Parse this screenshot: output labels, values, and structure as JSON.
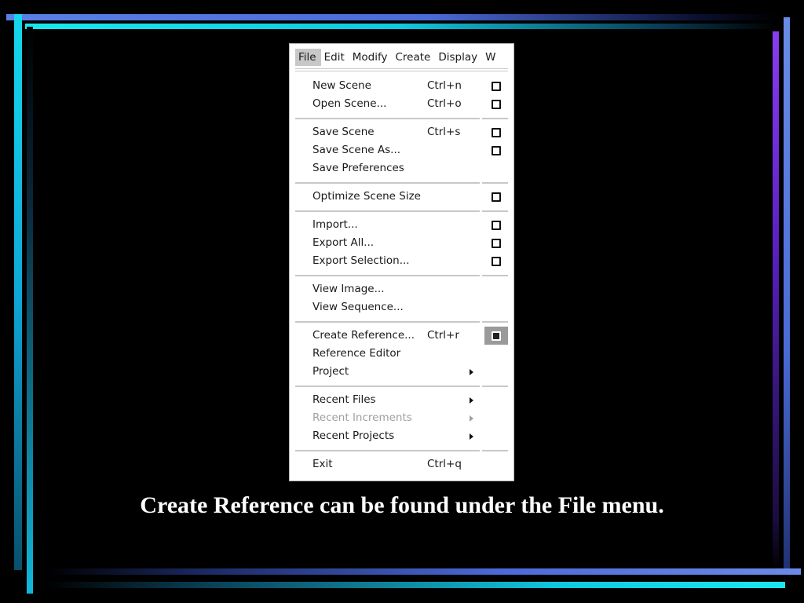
{
  "menubar": [
    {
      "label": "File",
      "active": true
    },
    {
      "label": "Edit"
    },
    {
      "label": "Modify"
    },
    {
      "label": "Create"
    },
    {
      "label": "Display"
    },
    {
      "label": "W"
    }
  ],
  "file_menu": {
    "groups": [
      [
        {
          "label": "New Scene",
          "shortcut": "Ctrl+n",
          "option_box": true
        },
        {
          "label": "Open Scene...",
          "shortcut": "Ctrl+o",
          "option_box": true
        }
      ],
      [
        {
          "label": "Save Scene",
          "shortcut": "Ctrl+s",
          "option_box": true
        },
        {
          "label": "Save Scene As...",
          "option_box": true
        },
        {
          "label": "Save Preferences"
        }
      ],
      [
        {
          "label": "Optimize Scene Size",
          "option_box": true
        }
      ],
      [
        {
          "label": "Import...",
          "option_box": true
        },
        {
          "label": "Export All...",
          "option_box": true
        },
        {
          "label": "Export Selection...",
          "option_box": true
        }
      ],
      [
        {
          "label": "View Image..."
        },
        {
          "label": "View Sequence..."
        }
      ],
      [
        {
          "label": "Create Reference...",
          "shortcut": "Ctrl+r",
          "option_box": true,
          "highlighted": true
        },
        {
          "label": "Reference Editor"
        },
        {
          "label": "Project",
          "submenu": true
        }
      ],
      [
        {
          "label": "Recent Files",
          "submenu": true
        },
        {
          "label": "Recent Increments",
          "submenu": true,
          "disabled": true
        },
        {
          "label": "Recent Projects",
          "submenu": true
        }
      ],
      [
        {
          "label": "Exit",
          "shortcut": "Ctrl+q"
        }
      ]
    ]
  },
  "icons": {
    "option_box": "option-box-icon",
    "submenu": "submenu-arrow-icon"
  },
  "colors": {
    "background": "#000000",
    "caption": "#ffffff",
    "highlight": "#9a9a9a",
    "disabled_text": "#a0a0a0"
  },
  "caption": "Create Reference can be found under the File menu."
}
